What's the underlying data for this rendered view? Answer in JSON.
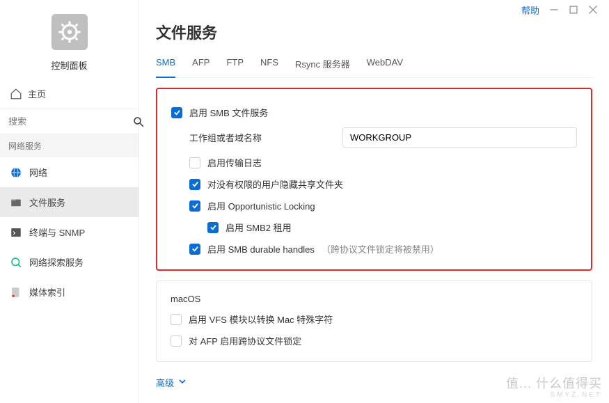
{
  "window": {
    "help": "帮助"
  },
  "sidebar": {
    "app_name": "控制面板",
    "home": "主页",
    "search_placeholder": "搜索",
    "section": "网络服务",
    "items": [
      {
        "label": "网络"
      },
      {
        "label": "文件服务"
      },
      {
        "label": "终端与 SNMP"
      },
      {
        "label": "网络探索服务"
      },
      {
        "label": "媒体索引"
      }
    ]
  },
  "page": {
    "title": "文件服务",
    "tabs": [
      "SMB",
      "AFP",
      "FTP",
      "NFS",
      "Rsync 服务器",
      "WebDAV"
    ],
    "advanced": "高级"
  },
  "smb": {
    "enable": "启用 SMB 文件服务",
    "workgroup_label": "工作组或者域名称",
    "workgroup_value": "WORKGROUP",
    "enable_log": "启用传输日志",
    "hide_unauthorized": "对没有权限的用户隐藏共享文件夹",
    "oplock": "启用 Opportunistic Locking",
    "smb2_leasing": "启用 SMB2 租用",
    "durable_handles": "启用 SMB durable handles",
    "durable_note": "（跨协议文件锁定将被禁用）"
  },
  "macos": {
    "title": "macOS",
    "vfs": "启用 VFS 模块以转换 Mac 特殊字符",
    "afp_lock": "对 AFP 启用跨协议文件锁定"
  },
  "watermark": {
    "line1": "值... 什么值得买",
    "line2": "SMYZ.NET"
  }
}
